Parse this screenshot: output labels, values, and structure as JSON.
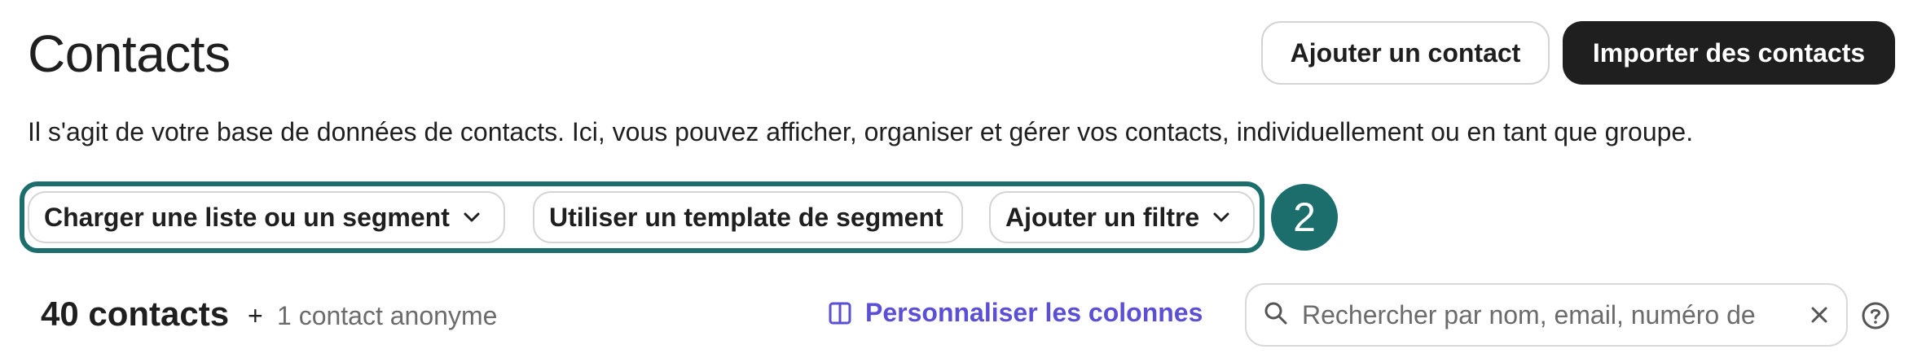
{
  "header": {
    "title": "Contacts",
    "add_contact_label": "Ajouter un contact",
    "import_contacts_label": "Importer des contacts"
  },
  "description": "Il s'agit de votre base de données de contacts. Ici, vous pouvez afficher, organiser et gérer vos contacts, individuellement ou en tant que groupe.",
  "filters": {
    "load_list_label": "Charger une liste ou un segment",
    "segment_template_label": "Utiliser un template de segment",
    "add_filter_label": "Ajouter un filtre",
    "step_number": "2"
  },
  "summary": {
    "count_label": "40 contacts",
    "plus": "+",
    "anonymous_label": "1 contact anonyme"
  },
  "toolbar": {
    "customize_columns_label": "Personnaliser les colonnes",
    "search_placeholder": "Rechercher par nom, email, numéro de",
    "search_value": ""
  },
  "icons": {
    "chevron": "chevron-down-icon",
    "columns": "columns-icon",
    "search": "search-icon",
    "clear": "close-icon",
    "help": "help-icon"
  },
  "colors": {
    "primary_dark": "#1f1f1f",
    "accent_teal": "#1b6e6c",
    "link_purple": "#5b4fd6",
    "muted_text": "#6b6b6b"
  }
}
